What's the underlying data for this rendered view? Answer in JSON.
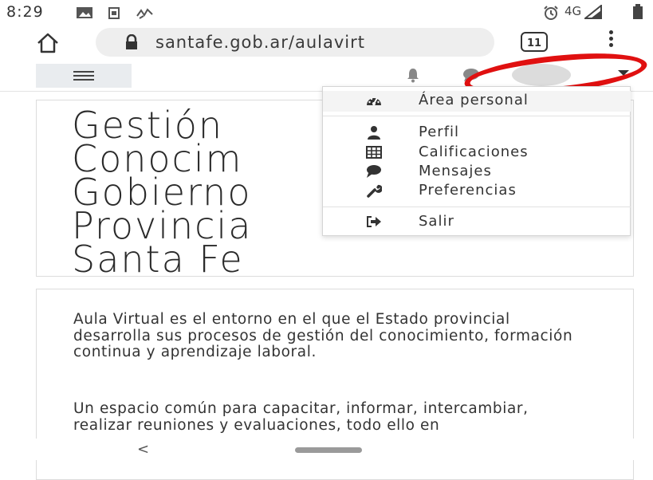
{
  "status_bar": {
    "time": "8:29",
    "network": "4G"
  },
  "browser": {
    "url": "santafe.gob.ar/aulavirt",
    "tab_count": "11"
  },
  "page": {
    "title_lines": [
      "Gestión",
      "Conocim",
      "Gobierno",
      "Provincia",
      "Santa Fe"
    ],
    "paragraph1": "Aula Virtual es el entorno en el que el Estado provincial desarrolla sus procesos de gestión del conocimiento, formación continua y aprendizaje laboral.",
    "paragraph2": "Un espacio común para capacitar, informar, intercambiar, realizar reuniones y evaluaciones, todo ello en"
  },
  "user_menu": {
    "items": [
      {
        "label": "Área personal",
        "icon": "dashboard-icon"
      },
      {
        "label": "Perfil",
        "icon": "user-icon"
      },
      {
        "label": "Calificaciones",
        "icon": "table-icon"
      },
      {
        "label": "Mensajes",
        "icon": "message-icon"
      },
      {
        "label": "Preferencias",
        "icon": "wrench-icon"
      },
      {
        "label": "Salir",
        "icon": "sign-out-icon"
      }
    ]
  },
  "bottom_nav": {
    "back": "<"
  },
  "colors": {
    "annotation_red": "#e01010",
    "menu_text": "#333333",
    "navbar_button_bg": "#e9ecef"
  }
}
